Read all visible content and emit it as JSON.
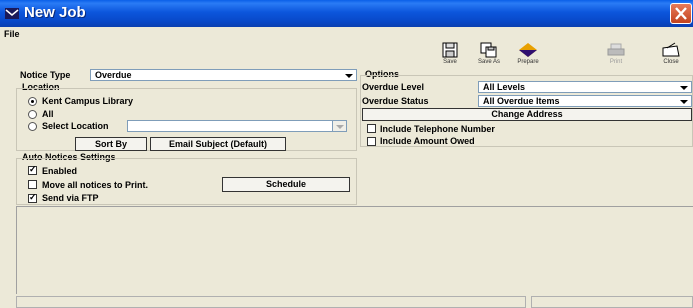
{
  "window": {
    "title": "New Job"
  },
  "menu": {
    "file": "File"
  },
  "toolbar": {
    "save": "Save",
    "save_as": "Save As",
    "prepare": "Prepare",
    "print": "Print",
    "close": "Close"
  },
  "notice_type": {
    "label": "Notice Type",
    "value": "Overdue"
  },
  "location": {
    "title": "Location",
    "options": [
      "Kent Campus Library",
      "All",
      "Select Location"
    ],
    "selected": "Kent Campus Library",
    "select_location_value": ""
  },
  "buttons": {
    "sort_by": "Sort By",
    "email_subject": "Email Subject (Default)",
    "schedule": "Schedule",
    "change_address": "Change Address"
  },
  "auto_notices": {
    "title": "Auto Notices Settings",
    "enabled": {
      "label": "Enabled",
      "checked": true
    },
    "move_all": {
      "label": "Move all notices to Print.",
      "checked": false
    },
    "send_ftp": {
      "label": "Send via FTP",
      "checked": true
    }
  },
  "options": {
    "title": "Options",
    "overdue_level": {
      "label": "Overdue Level",
      "value": "All Levels"
    },
    "overdue_status": {
      "label": "Overdue Status",
      "value": "All Overdue Items"
    },
    "include_phone": {
      "label": "Include Telephone Number",
      "checked": false
    },
    "include_amount": {
      "label": "Include Amount Owed",
      "checked": false
    }
  }
}
